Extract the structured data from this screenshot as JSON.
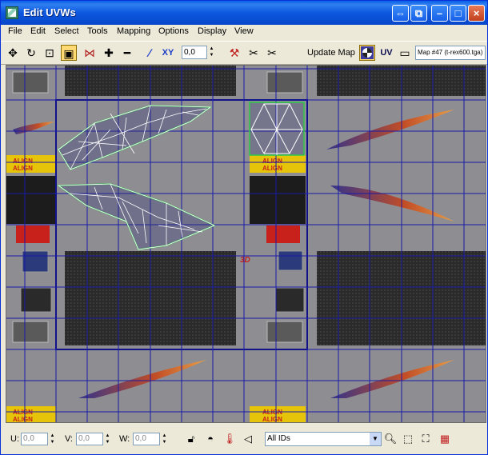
{
  "window": {
    "title": "Edit UVWs",
    "controls": [
      "⇔",
      "⧉",
      "–",
      "□",
      "×"
    ]
  },
  "menu": [
    "File",
    "Edit",
    "Select",
    "Tools",
    "Mapping",
    "Options",
    "Display",
    "View"
  ],
  "toolbar": {
    "tools_left": [
      {
        "name": "move-icon",
        "glyph": "✥"
      },
      {
        "name": "rotate-icon",
        "glyph": "↻"
      },
      {
        "name": "scale-icon",
        "glyph": "⊡"
      },
      {
        "name": "freeform-icon",
        "glyph": "▣"
      },
      {
        "name": "mirror-icon",
        "glyph": "⋈"
      },
      {
        "name": "expand-selection-icon",
        "glyph": "✚"
      },
      {
        "name": "contract-selection-icon",
        "glyph": "━"
      },
      {
        "name": "edge-loop-icon",
        "glyph": "∕"
      },
      {
        "name": "xy-icon",
        "glyph": "XY"
      }
    ],
    "spinner_value": "0,0",
    "tools_mid": [
      {
        "name": "weld-icon",
        "glyph": "⚒"
      },
      {
        "name": "break-icon",
        "glyph": "✂"
      },
      {
        "name": "detach-icon",
        "glyph": "✂"
      }
    ],
    "update_map": "Update Map",
    "uv_label": "UV",
    "map_name": "Map #47 (t-rex600.tga)"
  },
  "status": {
    "u_label": "U:",
    "u_value": "0,0",
    "v_label": "V:",
    "v_value": "0,0",
    "w_label": "W:",
    "w_value": "0,0",
    "ids_value": "All IDs",
    "tools": [
      "lock-icon",
      "hide-icon",
      "thermometer-icon",
      "freeze-icon",
      "zoom-icon",
      "zoom-region-icon",
      "zoom-extents-icon",
      "grid-snap-icon"
    ]
  },
  "texture": {
    "align_text": "ALIGN",
    "brand_3d": "3D"
  },
  "colors": {
    "grid": "#1a1aa8",
    "uv_edges": "#ffffff",
    "uv_border": "#2ec84a",
    "uv_frame": "#0a0a6e",
    "align_yellow": "#e6c40a",
    "align_red": "#c8201a"
  }
}
